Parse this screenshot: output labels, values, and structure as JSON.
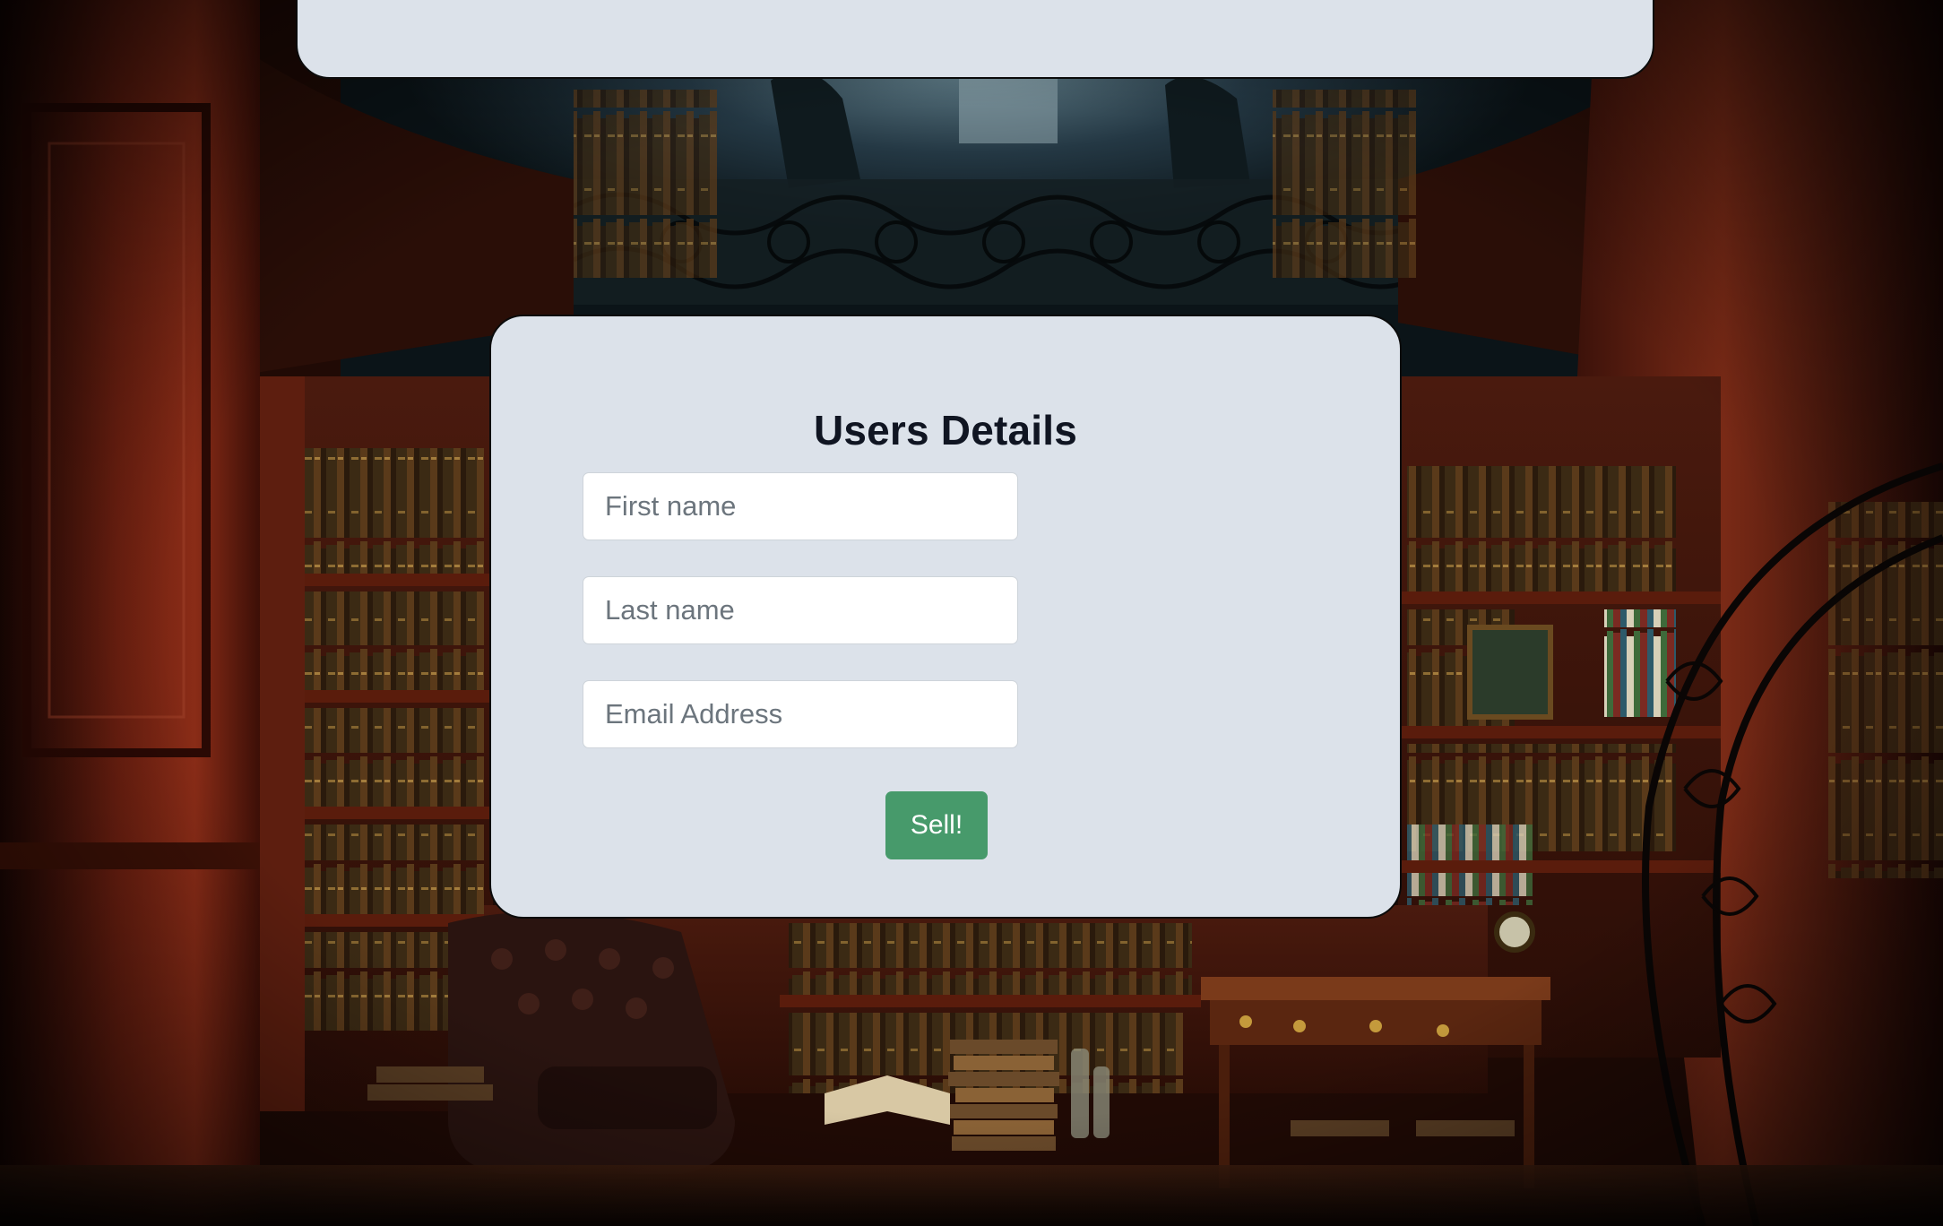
{
  "form": {
    "title": "Users Details",
    "first_name_placeholder": "First name",
    "last_name_placeholder": "Last name",
    "email_placeholder": "Email Address",
    "submit_label": "Sell!"
  },
  "colors": {
    "panel": "#dce2ea",
    "submit_button": "#479a6b",
    "title_text": "#101522"
  }
}
